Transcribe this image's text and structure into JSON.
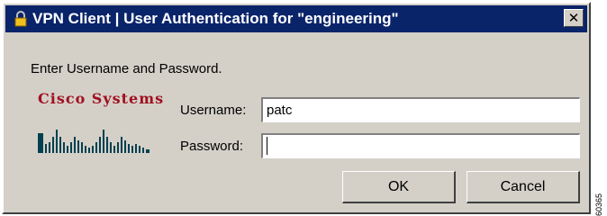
{
  "window": {
    "title": "VPN Client  |  User Authentication for \"engineering\"",
    "close_symbol": "✕",
    "title_icon": "lock-icon"
  },
  "prompt": "Enter Username and Password.",
  "logo": {
    "text": "Cisco Systems",
    "color": "#a01020"
  },
  "username": {
    "label": "Username:",
    "value": "patc"
  },
  "password": {
    "label": "Password:",
    "value": ""
  },
  "buttons": {
    "ok": "OK",
    "cancel": "Cancel"
  },
  "side_id": "60365"
}
